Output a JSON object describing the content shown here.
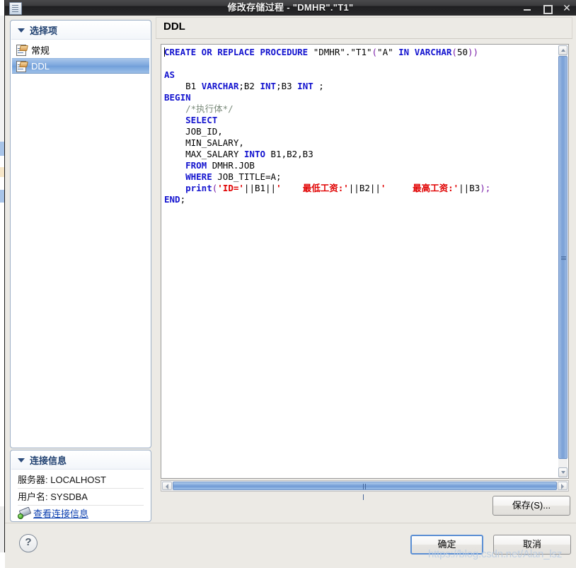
{
  "window": {
    "title": "修改存储过程 - \"DMHR\".\"T1\"",
    "icon": "document-window-icon",
    "minimize_label": "—",
    "maximize_label": "□",
    "close_label": "✕"
  },
  "sidebar": {
    "selection_panel": {
      "title": "选择项",
      "items": [
        {
          "label": "常规",
          "selected": false
        },
        {
          "label": "DDL",
          "selected": true
        }
      ]
    },
    "connection_panel": {
      "title": "连接信息",
      "rows": [
        {
          "label": "服务器: LOCALHOST"
        },
        {
          "label": "用户名: SYSDBA"
        }
      ],
      "link": "查看连接信息"
    }
  },
  "main": {
    "header": "DDL",
    "code_lines": [
      {
        "tokens": [
          {
            "t": "CREATE OR REPLACE PROCEDURE ",
            "c": "k"
          },
          {
            "t": "\"DMHR\".\"T1\"",
            "c": "n"
          },
          {
            "t": "(",
            "c": "p"
          },
          {
            "t": "\"A\" ",
            "c": "n"
          },
          {
            "t": "IN VARCHAR",
            "c": "k"
          },
          {
            "t": "(",
            "c": "p"
          },
          {
            "t": "50",
            "c": "n"
          },
          {
            "t": "))",
            "c": "p"
          }
        ]
      },
      {
        "tokens": []
      },
      {
        "tokens": [
          {
            "t": "AS",
            "c": "k"
          }
        ]
      },
      {
        "tokens": [
          {
            "t": "    B1 ",
            "c": "n"
          },
          {
            "t": "VARCHAR",
            "c": "k"
          },
          {
            "t": ";B2 ",
            "c": "n"
          },
          {
            "t": "INT",
            "c": "k"
          },
          {
            "t": ";B3 ",
            "c": "n"
          },
          {
            "t": "INT",
            "c": "k"
          },
          {
            "t": " ;",
            "c": "n"
          }
        ]
      },
      {
        "tokens": [
          {
            "t": "BEGIN",
            "c": "k"
          }
        ]
      },
      {
        "tokens": [
          {
            "t": "    /*执行体*/",
            "c": "c"
          }
        ]
      },
      {
        "tokens": [
          {
            "t": "    ",
            "c": "n"
          },
          {
            "t": "SELECT",
            "c": "k"
          }
        ]
      },
      {
        "tokens": [
          {
            "t": "    JOB_ID,",
            "c": "n"
          }
        ]
      },
      {
        "tokens": [
          {
            "t": "    MIN_SALARY,",
            "c": "n"
          }
        ]
      },
      {
        "tokens": [
          {
            "t": "    MAX_SALARY ",
            "c": "n"
          },
          {
            "t": "INTO",
            "c": "k"
          },
          {
            "t": " B1,B2,B3",
            "c": "n"
          }
        ]
      },
      {
        "tokens": [
          {
            "t": "    ",
            "c": "n"
          },
          {
            "t": "FROM",
            "c": "k"
          },
          {
            "t": " DMHR.JOB",
            "c": "n"
          }
        ]
      },
      {
        "tokens": [
          {
            "t": "    ",
            "c": "n"
          },
          {
            "t": "WHERE",
            "c": "k"
          },
          {
            "t": " JOB_TITLE=A;",
            "c": "n"
          }
        ]
      },
      {
        "tokens": [
          {
            "t": "    ",
            "c": "n"
          },
          {
            "t": "print",
            "c": "k"
          },
          {
            "t": "(",
            "c": "p"
          },
          {
            "t": "'ID='",
            "c": "s"
          },
          {
            "t": "||B1||",
            "c": "n"
          },
          {
            "t": "'    最低工资:'",
            "c": "s"
          },
          {
            "t": "||B2||",
            "c": "n"
          },
          {
            "t": "'     最高工资:'",
            "c": "s"
          },
          {
            "t": "||B3",
            "c": "n"
          },
          {
            "t": ");",
            "c": "p"
          }
        ]
      },
      {
        "tokens": [
          {
            "t": "END",
            "c": "k"
          },
          {
            "t": ";",
            "c": "n"
          }
        ]
      }
    ],
    "vscroll": {
      "up": "▲",
      "down": "▼"
    },
    "hscroll": {
      "left": "◀",
      "right": "▶"
    }
  },
  "buttons": {
    "save": "保存(S)...",
    "ok": "确定",
    "cancel": "取消",
    "help": "?"
  },
  "watermark": "https://blog.csdn.net/Alan_lsz",
  "colors": {
    "keyword": "#1414cf",
    "string": "#e00000",
    "comment": "#7a8a7a",
    "punct": "#7a1ea8",
    "selection": "#7ba6dd",
    "link": "#0b3fb0",
    "titlebar": "#2a2a2c"
  }
}
